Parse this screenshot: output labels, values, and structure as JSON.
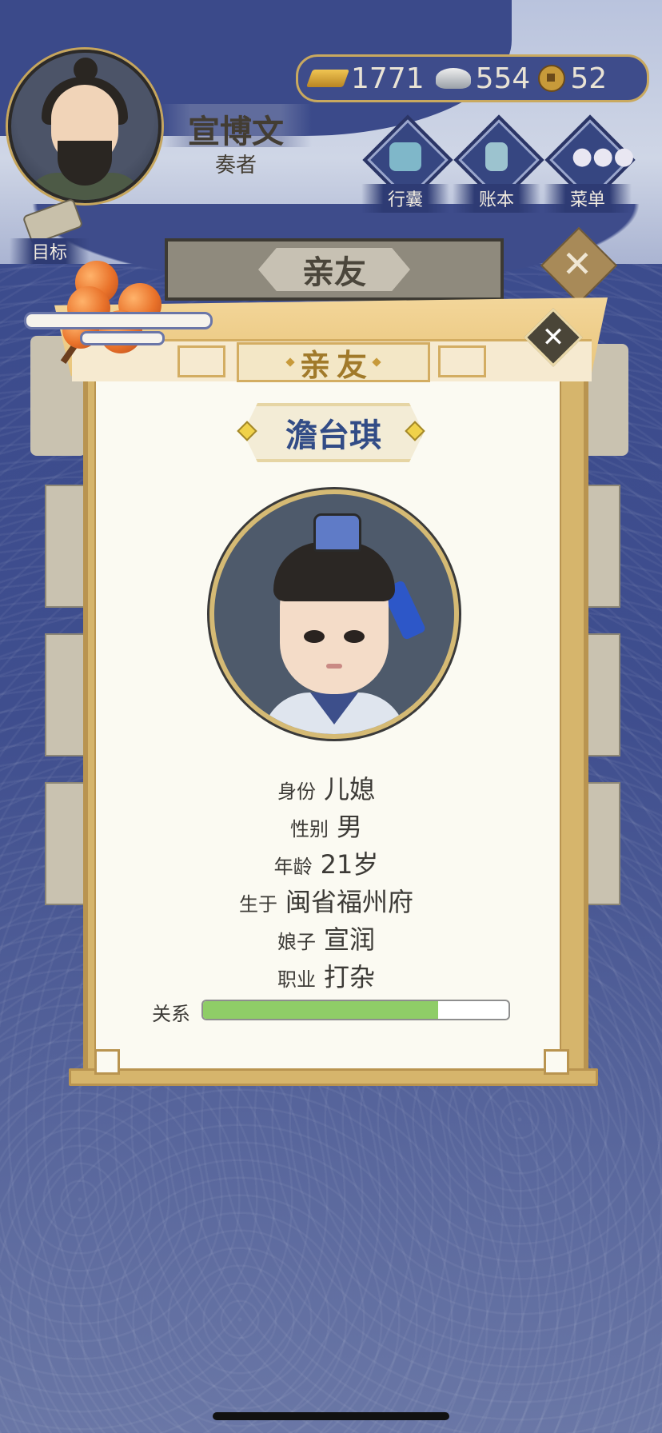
{
  "player": {
    "name": "宣博文",
    "title": "奏者"
  },
  "currency": {
    "gold": "1771",
    "silver": "554",
    "copper": "52"
  },
  "menu": {
    "bag_label": "行囊",
    "ledger_label": "账本",
    "menu_label": "菜单",
    "goal_label": "目标"
  },
  "background_panel": {
    "title": "亲友"
  },
  "modal": {
    "title": "亲友",
    "character_name": "澹台琪",
    "fields": [
      {
        "label": "身份",
        "value": "儿媳"
      },
      {
        "label": "性别",
        "value": "男"
      },
      {
        "label": "年龄",
        "value": "21岁"
      },
      {
        "label": "生于",
        "value": "闽省福州府"
      },
      {
        "label": "娘子",
        "value": "宣润"
      },
      {
        "label": "职业",
        "value": "打杂"
      }
    ],
    "relationship_label": "关系",
    "relationship_level": 0.77
  },
  "colors": {
    "accent_gold": "#d6b56c",
    "name_blue": "#324c86",
    "relation_green": "#8fcd67",
    "background_blue": "#3a4a8c"
  }
}
